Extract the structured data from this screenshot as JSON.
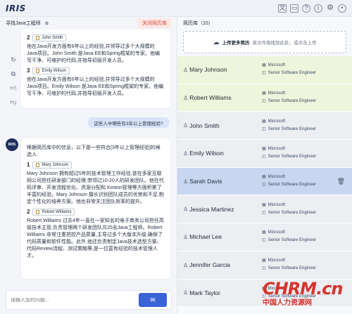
{
  "app": {
    "logo": "IRIS"
  },
  "topbar": {
    "icons": [
      "translate-icon",
      "window-icon",
      "help-icon",
      "info-icon",
      "settings-icon",
      "user-icon"
    ]
  },
  "chat": {
    "title": "寻找Java工程师",
    "close_label": "关闭简历库",
    "candidate2_num": "2",
    "candidate2_name": "John Smith",
    "candidate2_text": "他在Java开发方面有6年以上的经验,并领导过多个大规模的Java项目。John Smith 是Java EE和Spring框架的专家。他编写干净、可维护的代码,并指导初级开发人员。",
    "candidate3_num": "3",
    "candidate3_name": "Emily Wilson",
    "candidate3_text": "他在Java开发方面有6年以上的经验,并领导过多个大规模的Java项目。Emily Wilson 是Java EE和Spring框架的专家。他编写干净、可维护的代码,并指导初级开发人员。",
    "user_question": "这些人中哪些有3年以上管理经验?",
    "bot_avatar": "IRIS",
    "bot_intro": "根据简历库中的信息，以下是一些符合[3年以上管理经验]的候选人:",
    "r1_num": "1",
    "r1_name": "Mary Johnson",
    "r1_text": "Mary Johnson 拥有超过5年的技术管理工作经验,曾在多家互联网公司担任研发部门的经理,带领过10-20人的研发团队。他在代码评审、开发流程优化、资源分配和 Koston管理等方面积累了丰富的经验。Mary Johnson 擅长识别团队成员的优势和不足,制定个性化的培养方案。他也非常关注团队效率的提升。",
    "r2_num": "2",
    "r2_name": "Robert Williams",
    "r2_text": "Robert Williams 过去4年一直在一家知名的电子商务公司担任高级技术主管,负责管理两个研发团队共25名Java工程师。Robert Williams 非常注重把控产品质量,主导过多个大版本升级,确保了代码质量和软件性能。此外,他还负责制定Java技术选型方案、代码Review流程、测试策略等,是一位富有经验的技术管理人才。",
    "input_placeholder": "请输入您的问题..."
  },
  "library": {
    "title": "简历库（10）",
    "upload_bold": "上传更多简历",
    "upload_hint": "将文件拖拽到此处，或点击上传",
    "candidates": [
      {
        "name": "Mary Johnson",
        "company": "Microsoft",
        "title": "Senior Software Engineer",
        "state": "green"
      },
      {
        "name": "Robert Williams",
        "company": "Microsoft",
        "title": "Senior Software Engineer",
        "state": "green"
      },
      {
        "name": "John Smith",
        "company": "Microsoft",
        "title": "Senior Software Engineer",
        "state": "grey"
      },
      {
        "name": "Emily Wilson",
        "company": "Microsoft",
        "title": "Senior Software Engineer",
        "state": "grey"
      },
      {
        "name": "Sarah Davis",
        "company": "Microsoft",
        "title": "Senior Software Engineer",
        "state": "blue"
      },
      {
        "name": "Jessica Martinez",
        "company": "Microsoft",
        "title": "Senior Software Engineer",
        "state": "grey"
      },
      {
        "name": "Michael Lee",
        "company": "Microsoft",
        "title": "Senior Software Engineer",
        "state": "grey"
      },
      {
        "name": "Jennifer Garcia",
        "company": "Microsoft",
        "title": "Senior Software Engineer",
        "state": "grey"
      },
      {
        "name": "Mark Taylor",
        "company": "Microsoft",
        "title": "Senior Software Engineer",
        "state": "grey"
      }
    ]
  },
  "watermark": {
    "main": "CHRM.cn",
    "sub": "中国人力资源网"
  },
  "colors": {
    "accent": "#3a63d8",
    "close": "#d6453b",
    "row_green": "#eef5dc",
    "row_grey": "#eceef2",
    "row_selected": "#c8d6f0"
  }
}
